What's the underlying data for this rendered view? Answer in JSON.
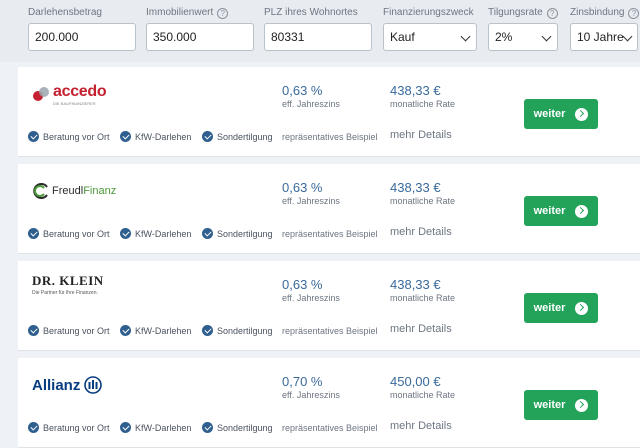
{
  "filters": {
    "loan_amount": {
      "label": "Darlehensbetrag",
      "value": "200.000"
    },
    "property_value": {
      "label": "Immobilienwert",
      "value": "350.000"
    },
    "zip": {
      "label": "PLZ ihres Wohnortes",
      "value": "80331"
    },
    "purpose": {
      "label": "Finanzierungszweck",
      "value": "Kauf"
    },
    "repayment": {
      "label": "Tilgungsrate",
      "value": "2%"
    },
    "fixed_term": {
      "label": "Zinsbindung",
      "value": "10 Jahre"
    }
  },
  "colors": {
    "accent_green": "#23a25a",
    "value_blue": "#3a6a9b",
    "check_blue": "#2f5f8e"
  },
  "offers": [
    {
      "provider": "accedo",
      "logo_sub": "DIE BAUFINANZIERER",
      "rate": "0,63 %",
      "rate_label": "eff. Jahreszins",
      "payment": "438,33 €",
      "payment_label": "monatliche Rate",
      "sample": "repräsentatives Beispiel",
      "details": "mehr Details",
      "button": "weiter",
      "features": [
        "Beratung vor Ort",
        "KfW-Darlehen",
        "Sondertilgung"
      ]
    },
    {
      "provider_a": "Freudl",
      "provider_b": "Finanz",
      "rate": "0,63 %",
      "rate_label": "eff. Jahreszins",
      "payment": "438,33 €",
      "payment_label": "monatliche Rate",
      "sample": "repräsentatives Beispiel",
      "details": "mehr Details",
      "button": "weiter",
      "features": [
        "Beratung vor Ort",
        "KfW-Darlehen",
        "Sondertilgung"
      ]
    },
    {
      "provider": "DR. KLEIN",
      "logo_sub": "Die Partner für Ihre Finanzen.",
      "rate": "0,63 %",
      "rate_label": "eff. Jahreszins",
      "payment": "438,33 €",
      "payment_label": "monatliche Rate",
      "sample": "repräsentatives Beispiel",
      "details": "mehr Details",
      "button": "weiter",
      "features": [
        "Beratung vor Ort",
        "KfW-Darlehen",
        "Sondertilgung"
      ]
    },
    {
      "provider": "Allianz",
      "rate": "0,70 %",
      "rate_label": "eff. Jahreszins",
      "payment": "450,00 €",
      "payment_label": "monatliche Rate",
      "sample": "repräsentatives Beispiel",
      "details": "mehr Details",
      "button": "weiter",
      "features": [
        "Beratung vor Ort",
        "KfW-Darlehen",
        "Sondertilgung"
      ]
    }
  ]
}
